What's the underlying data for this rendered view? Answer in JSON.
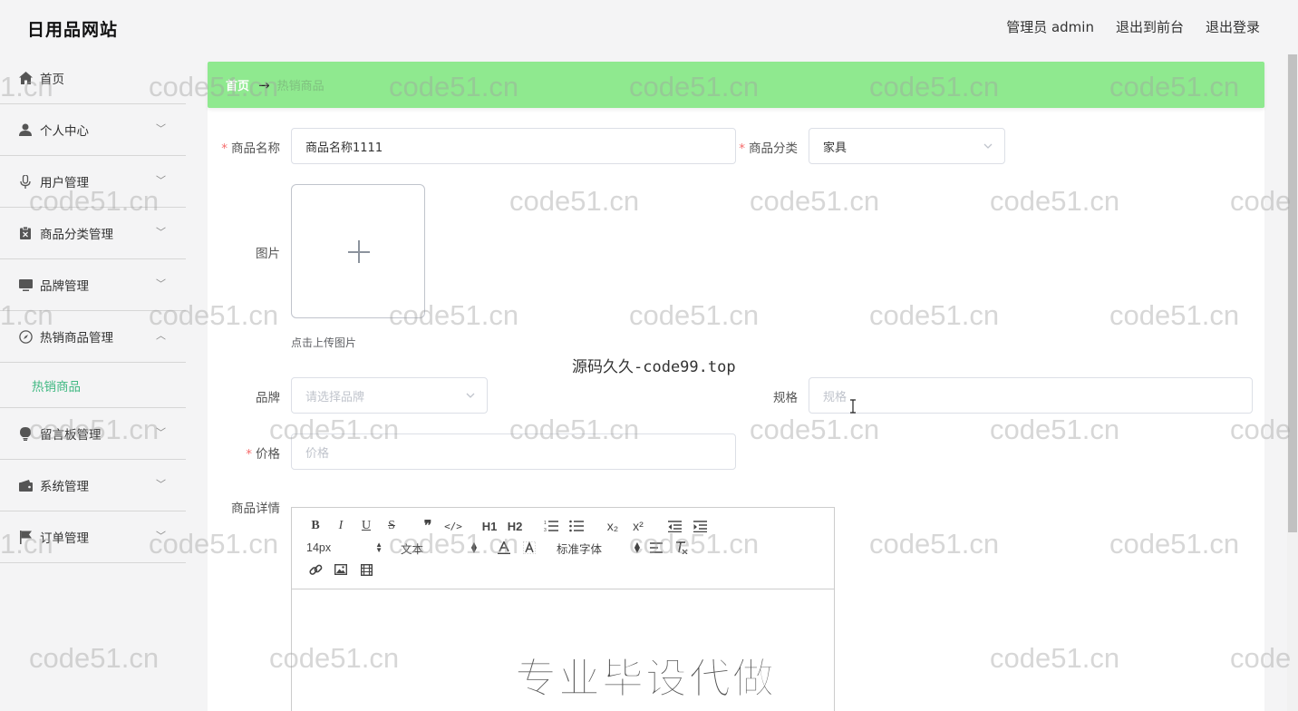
{
  "header": {
    "brand": "日用品网站",
    "admin_label": "管理员 admin",
    "to_front": "退出到前台",
    "logout": "退出登录"
  },
  "sidebar": {
    "items": [
      {
        "label": "首页",
        "icon": "home-icon"
      },
      {
        "label": "个人中心",
        "icon": "user-icon"
      },
      {
        "label": "用户管理",
        "icon": "microphone-icon"
      },
      {
        "label": "商品分类管理",
        "icon": "clipboard-icon"
      },
      {
        "label": "品牌管理",
        "icon": "monitor-icon"
      },
      {
        "label": "热销商品管理",
        "icon": "compass-icon"
      },
      {
        "label": "留言板管理",
        "icon": "bulb-icon"
      },
      {
        "label": "系统管理",
        "icon": "wallet-icon"
      },
      {
        "label": "订单管理",
        "icon": "flag-icon"
      }
    ],
    "submenu_active": "热销商品"
  },
  "breadcrumb": {
    "home": "首页",
    "arrow": "→",
    "current": "热销商品"
  },
  "form": {
    "name_label": "商品名称",
    "name_value": "商品名称1111",
    "category_label": "商品分类",
    "category_value": "家具",
    "image_label": "图片",
    "upload_tip": "点击上传图片",
    "brand_label": "品牌",
    "brand_placeholder": "请选择品牌",
    "spec_label": "规格",
    "spec_placeholder": "规格",
    "price_label": "价格",
    "price_placeholder": "价格",
    "detail_label": "商品详情",
    "required_mark": "*"
  },
  "editor": {
    "font_size": "14px",
    "header_select": "文本",
    "font_family": "标准字体",
    "buttons_row1": [
      "B",
      "I",
      "U",
      "S",
      "❞",
      "</>",
      "H1",
      "H2",
      "ol",
      "ul",
      "x₂",
      "x²",
      "outdent",
      "indent"
    ]
  },
  "watermarks": {
    "repeat_text": "code51.cn",
    "partial_text": "1.cn",
    "partial_right": "code",
    "center_text": "源码久久-code99.top",
    "big_text": "专业毕设代做"
  },
  "colors": {
    "accent_green": "#42b983",
    "breadcrumb_bg": "#8fe98f",
    "required_red": "#f56c6c"
  }
}
